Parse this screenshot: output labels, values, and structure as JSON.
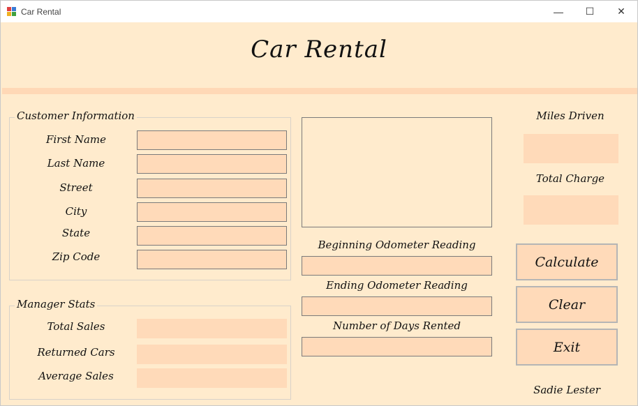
{
  "window": {
    "title": "Car Rental",
    "minimize": "—",
    "maximize": "☐",
    "close": "✕"
  },
  "header": {
    "title": "Car Rental"
  },
  "customer": {
    "legend": "Customer Information",
    "fields": [
      {
        "label": "First Name",
        "value": ""
      },
      {
        "label": "Last Name",
        "value": ""
      },
      {
        "label": "Street",
        "value": ""
      },
      {
        "label": "City",
        "value": ""
      },
      {
        "label": "State",
        "value": ""
      },
      {
        "label": "Zip Code",
        "value": ""
      }
    ]
  },
  "manager": {
    "legend": "Manager Stats",
    "fields": [
      {
        "label": "Total Sales",
        "value": ""
      },
      {
        "label": "Returned Cars",
        "value": ""
      },
      {
        "label": "Average Sales",
        "value": ""
      }
    ]
  },
  "odometer": {
    "beginning_label": "Beginning Odometer Reading",
    "beginning_value": "",
    "ending_label": "Ending Odometer Reading",
    "ending_value": "",
    "days_label": "Number of Days Rented",
    "days_value": ""
  },
  "results": {
    "miles_label": "Miles Driven",
    "miles_value": "",
    "charge_label": "Total Charge",
    "charge_value": ""
  },
  "buttons": {
    "calculate": "Calculate",
    "clear": "Clear",
    "exit": "Exit"
  },
  "footer": {
    "author": "Sadie Lester"
  },
  "colors": {
    "background": "#ffebcd",
    "field": "#ffdab9",
    "band": "#ffd8b6"
  }
}
